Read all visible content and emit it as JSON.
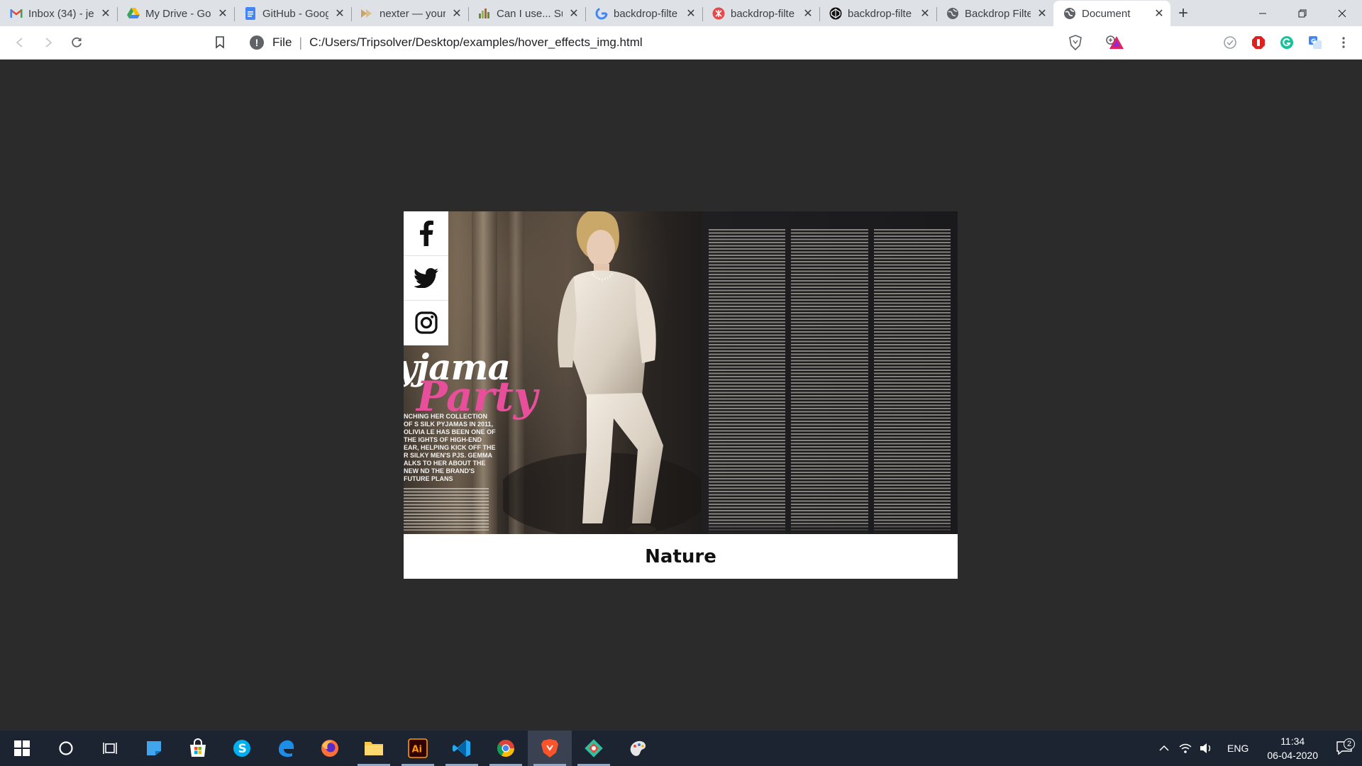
{
  "browser": {
    "tabs": [
      {
        "title": "Inbox (34) - je",
        "icon": "gmail-icon",
        "active": false
      },
      {
        "title": "My Drive - Go",
        "icon": "drive-icon",
        "active": false
      },
      {
        "title": "GitHub - Goog",
        "icon": "docs-icon",
        "active": false
      },
      {
        "title": "nexter — your",
        "icon": "nexter-icon",
        "active": false
      },
      {
        "title": "Can I use... Su",
        "icon": "caniuse-icon",
        "active": false
      },
      {
        "title": "backdrop-filte",
        "icon": "google-icon",
        "active": false
      },
      {
        "title": "backdrop-filte",
        "icon": "css-tricks-icon",
        "active": false
      },
      {
        "title": "backdrop-filte",
        "icon": "codepen-icon",
        "active": false
      },
      {
        "title": "Backdrop Filte",
        "icon": "globe-icon",
        "active": false
      },
      {
        "title": "Document",
        "icon": "globe-icon",
        "active": true
      }
    ],
    "address": {
      "scheme_label": "File",
      "url": "C:/Users/Tripsolver/Desktop/examples/hover_effects_img.html"
    }
  },
  "page": {
    "card": {
      "caption": "Nature",
      "social": [
        {
          "name": "facebook",
          "icon": "facebook-icon"
        },
        {
          "name": "twitter",
          "icon": "twitter-icon"
        },
        {
          "name": "instagram",
          "icon": "instagram-icon"
        }
      ],
      "image": {
        "headline_1": "yjama",
        "headline_2": "Party",
        "lede": "NCHING HER COLLECTION OF S SILK PYJAMAS IN 2011, OLIVIA LE HAS BEEN ONE OF THE IGHTS OF HIGH-END EAR, HELPING KICK OFF THE R SILKY MEN'S PJS. GEMMA ALKS TO HER ABOUT THE NEW ND THE BRAND'S FUTURE PLANS"
      }
    }
  },
  "taskbar": {
    "apps": [
      {
        "name": "start",
        "icon": "windows-icon"
      },
      {
        "name": "search",
        "icon": "cortana-icon"
      },
      {
        "name": "task-view",
        "icon": "task-view-icon"
      },
      {
        "name": "whiteboard",
        "icon": "whiteboard-icon"
      },
      {
        "name": "store",
        "icon": "store-icon"
      },
      {
        "name": "skype",
        "icon": "skype-icon"
      },
      {
        "name": "edge",
        "icon": "edge-icon"
      },
      {
        "name": "firefox",
        "icon": "firefox-icon"
      },
      {
        "name": "explorer",
        "icon": "folder-icon"
      },
      {
        "name": "illustrator",
        "icon": "illustrator-icon"
      },
      {
        "name": "vscode",
        "icon": "vscode-icon"
      },
      {
        "name": "chrome",
        "icon": "chrome-icon"
      },
      {
        "name": "brave",
        "icon": "brave-icon"
      },
      {
        "name": "sourcetree",
        "icon": "sourcetree-icon"
      },
      {
        "name": "paint",
        "icon": "paint-icon"
      }
    ],
    "tray": {
      "language": "ENG",
      "time": "11:34",
      "date": "06-04-2020",
      "notifications": "2"
    }
  },
  "colors": {
    "page_bg": "#2b2b2b",
    "accent_pink": "#e84f9b",
    "taskbar_bg": "#1c2431"
  }
}
